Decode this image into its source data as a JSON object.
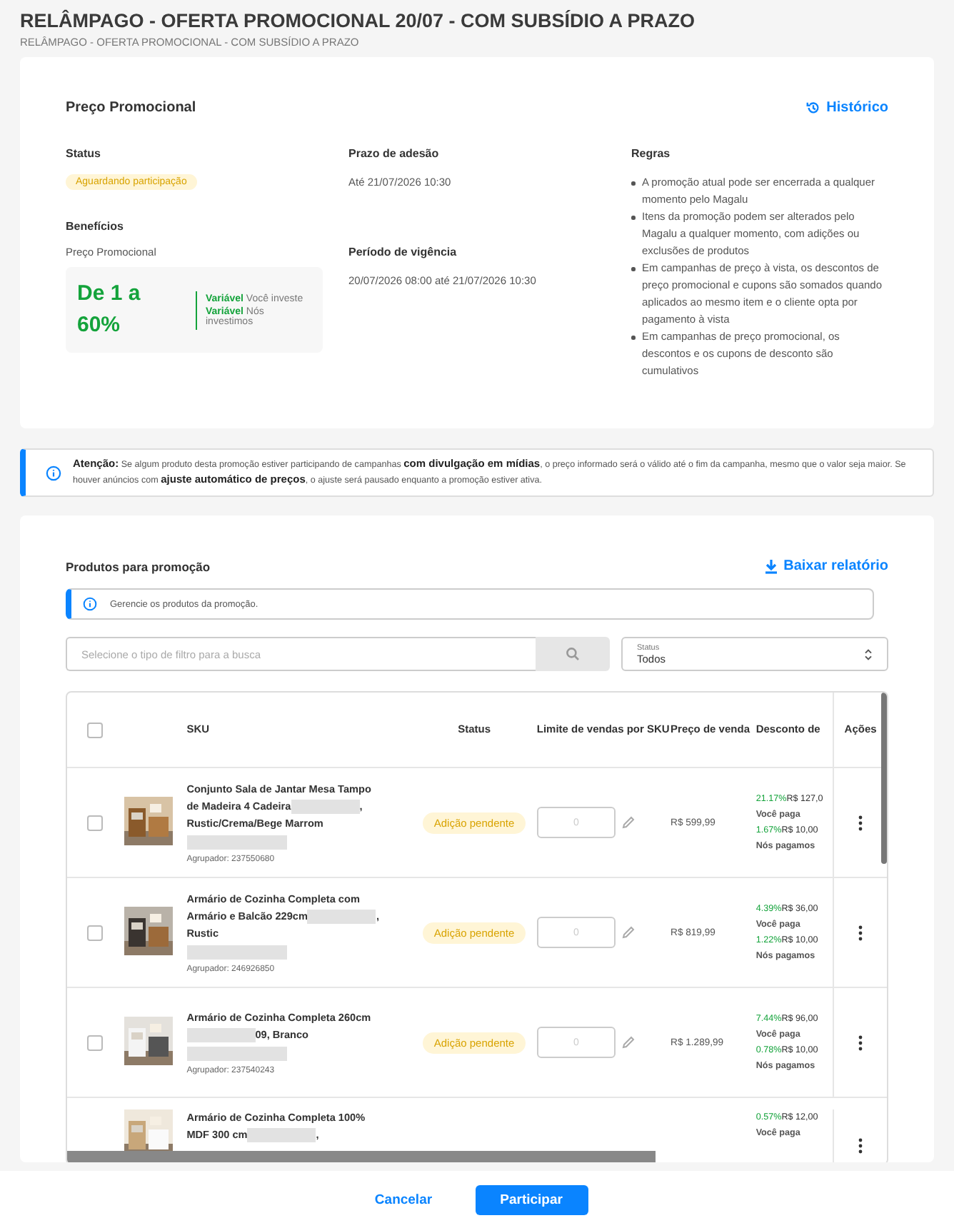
{
  "page": {
    "title": "RELÂMPAGO - OFERTA PROMOCIONAL 20/07 - COM SUBSÍDIO A PRAZO",
    "breadcrumb": "RELÂMPAGO - OFERTA PROMOCIONAL - COM SUBSÍDIO A PRAZO"
  },
  "promo": {
    "title": "Preço Promocional",
    "history_link": "Histórico",
    "status_label": "Status",
    "status": "Aguardando participação",
    "benefits_label": "Benefícios",
    "benefit_type": "Preço Promocional",
    "benefit_range": "De 1 a 60%",
    "benefit_lines": [
      {
        "tag": "Variável",
        "text": "Você investe"
      },
      {
        "tag": "Variável",
        "text": "Nós investimos"
      }
    ],
    "deadline_label": "Prazo de adesão",
    "deadline": "Até 21/07/2026 10:30",
    "period_label": "Período de vigência",
    "period": "20/07/2026 08:00 até 21/07/2026 10:30",
    "rules_label": "Regras",
    "rules": [
      "A promoção atual pode ser encerrada a qualquer momento pelo Magalu",
      "Itens da promoção podem ser alterados pelo Magalu a qualquer momento, com adições ou exclusões de produtos",
      "Em campanhas de preço à vista, os descontos de preço promocional e cupons são somados quando aplicados ao mesmo item e o cliente opta por pagamento à vista",
      "Em campanhas de preço promocional, os descontos e os cupons de desconto são cumulativos"
    ]
  },
  "alert": "**Atenção:** Se algum produto desta promoção estiver participando de campanhas **com divulgação em mídias**, o preço informado será o válido até o fim da campanha, mesmo que o valor seja maior. Se houver anúncios com **ajuste automático de preços**, o ajuste será pausado enquanto a promoção estiver ativa.",
  "products": {
    "title": "Produtos para promoção",
    "download_link": "Baixar relatório",
    "info": "Gerencie os produtos da promoção.",
    "search": {
      "placeholder": "Selecione o tipo de filtro para a busca"
    },
    "status_filter": {
      "label": "Status",
      "value": "Todos"
    },
    "select_all_checked": false,
    "columns": [
      "SKU",
      "Status",
      "Limite de vendas por SKU",
      "Preço de venda",
      "Desconto de",
      "Ações"
    ],
    "rows": [
      {
        "checked": false,
        "name": [
          {
            "kind": "text",
            "text": "Conjunto Sala de Jantar Mesa Tampo de Madeira 4 Cadeira"
          },
          {
            "kind": "redacted"
          },
          {
            "kind": "text",
            "text": ", Rustic/Crema/Bege Marrom"
          },
          {
            "kind": "redacted"
          }
        ],
        "group": "Agrupador: 237550680",
        "status": "Adição pendente",
        "limit_placeholder": "0",
        "price": "R$ 599,99",
        "discounts": [
          {
            "pct": "21.17%",
            "value": "R$ 127,0",
            "who": "Você paga"
          },
          {
            "pct": "1.67%",
            "value": "R$ 10,00",
            "who": "Nós pagamos"
          }
        ]
      },
      {
        "checked": false,
        "name": [
          {
            "kind": "text",
            "text": "Armário de Cozinha Completa com Armário e Balcão 229cm"
          },
          {
            "kind": "redacted"
          },
          {
            "kind": "text",
            "text": ", Rustic"
          },
          {
            "kind": "redacted"
          }
        ],
        "group": "Agrupador: 246926850",
        "status": "Adição pendente",
        "limit_placeholder": "0",
        "price": "R$ 819,99",
        "discounts": [
          {
            "pct": "4.39%",
            "value": "R$ 36,00",
            "who": "Você paga"
          },
          {
            "pct": "1.22%",
            "value": "R$ 10,00",
            "who": "Nós pagamos"
          }
        ]
      },
      {
        "checked": false,
        "name": [
          {
            "kind": "text",
            "text": "Armário de Cozinha Completa 260cm"
          },
          {
            "kind": "redacted"
          },
          {
            "kind": "text",
            "text": "09, Branco"
          },
          {
            "kind": "redacted"
          }
        ],
        "group": "Agrupador: 237540243",
        "status": "Adição pendente",
        "limit_placeholder": "0",
        "price": "R$ 1.289,99",
        "discounts": [
          {
            "pct": "7.44%",
            "value": "R$ 96,00",
            "who": "Você paga"
          },
          {
            "pct": "0.78%",
            "value": "R$ 10,00",
            "who": "Nós pagamos"
          }
        ]
      },
      {
        "name": [
          {
            "kind": "text",
            "text": "Armário de Cozinha Completa 100% MDF 300 cm"
          },
          {
            "kind": "redacted"
          },
          {
            "kind": "text",
            "text": ","
          }
        ],
        "discounts": [
          {
            "pct": "0.57%",
            "value": "R$ 12,00",
            "who": "Você paga"
          }
        ]
      }
    ]
  },
  "footer": {
    "cancel": "Cancelar",
    "submit": "Participar"
  }
}
